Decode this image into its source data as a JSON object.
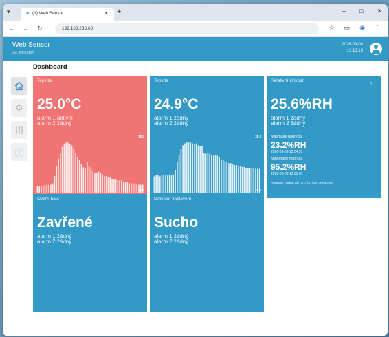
{
  "browser": {
    "tab_title": "(1) Web Sensor",
    "url": "192.168.236.60"
  },
  "header": {
    "title": "Web Sensor",
    "serial": "s/n: 24001127",
    "date": "2026-03-09",
    "time": "13:13:13"
  },
  "page_title": "Dashboard",
  "sidebar": {
    "items": [
      {
        "icon": "home-icon",
        "active": true
      },
      {
        "icon": "gear-icon",
        "active": false
      },
      {
        "icon": "sliders-icon",
        "active": false
      },
      {
        "icon": "info-icon",
        "active": false
      }
    ]
  },
  "cards": {
    "temp1": {
      "label": "Teplota",
      "value": "25.0°C",
      "alarm1": "alarm 1 aktivní",
      "alarm2": "alarm 2 žádný",
      "chart_max": "28.3",
      "chart_min": "24.6",
      "status_color": "#f07474"
    },
    "temp2": {
      "label": "Teplota",
      "value": "24.9°C",
      "alarm1": "alarm 1 žádný",
      "alarm2": "alarm 2 žádný",
      "chart_max": "28.3",
      "chart_min": "22.6",
      "status_color": "#3399c6"
    },
    "humidity": {
      "label": "Relativní vlhkost",
      "value": "25.6%RH",
      "alarm1": "alarm 1 žádný",
      "alarm2": "alarm 2 žádný",
      "min_label": "Minimální hodnota",
      "min_value": "23.2%RH",
      "min_time": "2026-03-09 13:04:31",
      "max_label": "Maximální hodnota",
      "max_value": "95.2%RH",
      "max_time": "2026-03-09 13:02:07",
      "valid_since": "Hodnoty platné od: 2026-03-09 09:45:48"
    },
    "door": {
      "label": "Ovéřn hala",
      "value": "Zavřené",
      "alarm1": "alarm 1 žádný",
      "alarm2": "alarm 2 žádný"
    },
    "flood": {
      "label": "Detektor zaplavení",
      "value": "Sucho",
      "alarm1": "alarm 1 žádný",
      "alarm2": "alarm 2 žádný"
    }
  },
  "chart_data": [
    {
      "type": "bar",
      "title": "",
      "ylim": [
        24.6,
        28.3
      ],
      "values": [
        24.9,
        24.9,
        24.9,
        24.95,
        24.95,
        25.0,
        25.0,
        25.0,
        25.1,
        25.6,
        26.3,
        26.8,
        27.2,
        27.6,
        27.8,
        27.9,
        27.9,
        27.8,
        27.7,
        27.5,
        27.2,
        26.9,
        26.7,
        26.4,
        26.2,
        26.1,
        26.6,
        26.3,
        26.1,
        25.9,
        25.8,
        25.8,
        25.9,
        25.8,
        25.7,
        25.6,
        25.6,
        25.5,
        25.5,
        25.4,
        25.4,
        25.4,
        25.3,
        25.3,
        25.3,
        25.2,
        25.2,
        25.2,
        25.1,
        25.1,
        25.1,
        25.05,
        25.05,
        25.0,
        25.0,
        25.0
      ]
    },
    {
      "type": "bar",
      "title": "",
      "ylim": [
        22.6,
        28.3
      ],
      "values": [
        24.1,
        24.2,
        24.2,
        24.1,
        24.2,
        24.3,
        24.2,
        24.2,
        24.3,
        24.2,
        24.3,
        24.8,
        25.6,
        26.4,
        27.0,
        27.4,
        27.6,
        27.7,
        27.7,
        27.7,
        27.6,
        27.5,
        27.6,
        27.4,
        27.3,
        27.3,
        26.6,
        26.5,
        26.6,
        26.5,
        26.4,
        26.3,
        26.4,
        26.3,
        26.1,
        25.9,
        25.8,
        25.7,
        25.6,
        25.5,
        25.5,
        25.4,
        25.3,
        25.3,
        25.2,
        25.2,
        25.1,
        25.1,
        25.0,
        25.0,
        25.0,
        24.95,
        24.95,
        24.9,
        24.9,
        24.9
      ]
    }
  ],
  "colors": {
    "primary": "#3399c6",
    "alarm": "#f07474",
    "header": "#3399c6"
  }
}
